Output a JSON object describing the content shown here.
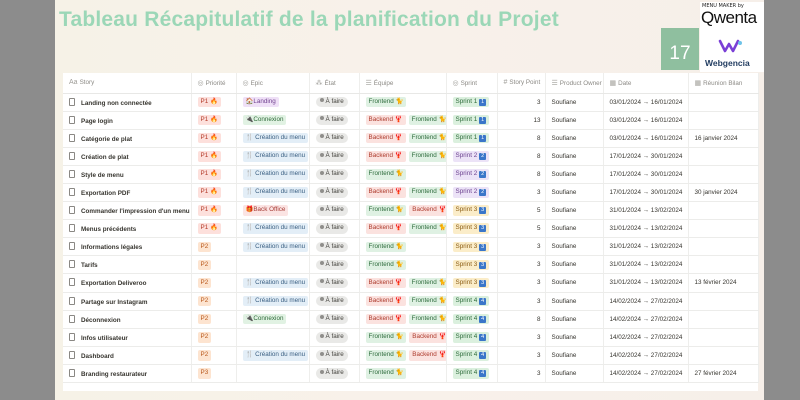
{
  "title": "Tableau Récapitulatif de la planification du Projet",
  "page_number": "17",
  "logo": {
    "maker": "MENU MAKER by",
    "brand": "Qwenta",
    "partner": "Webgencia"
  },
  "colors": {
    "title": "#9bd7b7",
    "page_badge": "#8fbf9f",
    "sprint_badge": "#3a76c9"
  },
  "columns": [
    {
      "label": "Story",
      "icon": "Aa"
    },
    {
      "label": "Priorité",
      "icon": "status-icon"
    },
    {
      "label": "Epic",
      "icon": "status-icon"
    },
    {
      "label": "État",
      "icon": "loader-icon"
    },
    {
      "label": "Équipe",
      "icon": "list-icon"
    },
    {
      "label": "Sprint",
      "icon": "status-icon"
    },
    {
      "label": "Story Point",
      "icon": "hash-icon"
    },
    {
      "label": "Product Owner",
      "icon": "list-icon"
    },
    {
      "label": "Date",
      "icon": "calendar-icon"
    },
    {
      "label": "Réunion Bilan",
      "icon": "calendar-icon"
    }
  ],
  "rows": [
    {
      "story": "Landing non connectée",
      "priority": "P1 🔥",
      "epic": "🏠Landing",
      "state": "À faire",
      "teams": [
        "Frontend 🐈"
      ],
      "sprint": "Sprint 1",
      "sprint_num": "1",
      "points": "3",
      "po": "Soufiane",
      "date": "03/01/2024 → 16/01/2024",
      "review": ""
    },
    {
      "story": "Page login",
      "priority": "P1 🔥",
      "epic": "🔌Connexion",
      "state": "À faire",
      "teams": [
        "Backend 🦞",
        "Frontend 🐈"
      ],
      "sprint": "Sprint 1",
      "sprint_num": "1",
      "points": "13",
      "po": "Soufiane",
      "date": "03/01/2024 → 16/01/2024",
      "review": ""
    },
    {
      "story": "Catégorie de plat",
      "priority": "P1 🔥",
      "epic": "🍴 Création du menu",
      "state": "À faire",
      "teams": [
        "Backend 🦞",
        "Frontend 🐈"
      ],
      "sprint": "Sprint 1",
      "sprint_num": "1",
      "points": "8",
      "po": "Soufiane",
      "date": "03/01/2024 → 16/01/2024",
      "review": "16 janvier 2024"
    },
    {
      "story": "Création de plat",
      "priority": "P1 🔥",
      "epic": "🍴 Création du menu",
      "state": "À faire",
      "teams": [
        "Backend 🦞",
        "Frontend 🐈"
      ],
      "sprint": "Sprint 2",
      "sprint_num": "2",
      "points": "8",
      "po": "Soufiane",
      "date": "17/01/2024 → 30/01/2024",
      "review": ""
    },
    {
      "story": "Style de menu",
      "priority": "P1 🔥",
      "epic": "🍴 Création du menu",
      "state": "À faire",
      "teams": [
        "Frontend 🐈"
      ],
      "sprint": "Sprint 2",
      "sprint_num": "2",
      "points": "8",
      "po": "Soufiane",
      "date": "17/01/2024 → 30/01/2024",
      "review": ""
    },
    {
      "story": "Exportation PDF",
      "priority": "P1 🔥",
      "epic": "🍴 Création du menu",
      "state": "À faire",
      "teams": [
        "Backend 🦞",
        "Frontend 🐈"
      ],
      "sprint": "Sprint 2",
      "sprint_num": "2",
      "points": "3",
      "po": "Soufiane",
      "date": "17/01/2024 → 30/01/2024",
      "review": "30 janvier 2024"
    },
    {
      "story": "Commander l'impression d'un menu",
      "priority": "P1 🔥",
      "epic": "🎁Back Office",
      "state": "À faire",
      "teams": [
        "Frontend 🐈",
        "Backend 🦞"
      ],
      "sprint": "Sprint 3",
      "sprint_num": "3",
      "points": "5",
      "po": "Soufiane",
      "date": "31/01/2024 → 13/02/2024",
      "review": ""
    },
    {
      "story": "Menus précédents",
      "priority": "P1 🔥",
      "epic": "🍴 Création du menu",
      "state": "À faire",
      "teams": [
        "Backend 🦞",
        "Frontend 🐈"
      ],
      "sprint": "Sprint 3",
      "sprint_num": "3",
      "points": "5",
      "po": "Soufiane",
      "date": "31/01/2024 → 13/02/2024",
      "review": ""
    },
    {
      "story": "Informations légales",
      "priority": "P2",
      "epic": "🍴 Création du menu",
      "state": "À faire",
      "teams": [
        "Frontend 🐈"
      ],
      "sprint": "Sprint 3",
      "sprint_num": "3",
      "points": "3",
      "po": "Soufiane",
      "date": "31/01/2024 → 13/02/2024",
      "review": ""
    },
    {
      "story": "Tarifs",
      "priority": "P2",
      "epic": "",
      "state": "À faire",
      "teams": [
        "Frontend 🐈"
      ],
      "sprint": "Sprint 3",
      "sprint_num": "3",
      "points": "3",
      "po": "Soufiane",
      "date": "31/01/2024 → 13/02/2024",
      "review": ""
    },
    {
      "story": "Exportation Deliveroo",
      "priority": "P2",
      "epic": "🍴 Création du menu",
      "state": "À faire",
      "teams": [
        "Backend 🦞",
        "Frontend 🐈"
      ],
      "sprint": "Sprint 3",
      "sprint_num": "3",
      "points": "3",
      "po": "Soufiane",
      "date": "31/01/2024 → 13/02/2024",
      "review": "13 février 2024"
    },
    {
      "story": "Partage sur Instagram",
      "priority": "P2",
      "epic": "🍴 Création du menu",
      "state": "À faire",
      "teams": [
        "Backend 🦞",
        "Frontend 🐈"
      ],
      "sprint": "Sprint 4",
      "sprint_num": "4",
      "points": "3",
      "po": "Soufiane",
      "date": "14/02/2024 → 27/02/2024",
      "review": ""
    },
    {
      "story": "Déconnexion",
      "priority": "P2",
      "epic": "🔌Connexion",
      "state": "À faire",
      "teams": [
        "Backend 🦞",
        "Frontend 🐈"
      ],
      "sprint": "Sprint 4",
      "sprint_num": "4",
      "points": "8",
      "po": "Soufiane",
      "date": "14/02/2024 → 27/02/2024",
      "review": ""
    },
    {
      "story": "Infos utilisateur",
      "priority": "P2",
      "epic": "",
      "state": "À faire",
      "teams": [
        "Frontend 🐈",
        "Backend 🦞"
      ],
      "sprint": "Sprint 4",
      "sprint_num": "4",
      "points": "3",
      "po": "Soufiane",
      "date": "14/02/2024 → 27/02/2024",
      "review": ""
    },
    {
      "story": "Dashboard",
      "priority": "P2",
      "epic": "🍴 Création du menu",
      "state": "À faire",
      "teams": [
        "Frontend 🐈",
        "Backend 🦞"
      ],
      "sprint": "Sprint 4",
      "sprint_num": "4",
      "points": "3",
      "po": "Soufiane",
      "date": "14/02/2024 → 27/02/2024",
      "review": ""
    },
    {
      "story": "Branding restaurateur",
      "priority": "P3",
      "epic": "",
      "state": "À faire",
      "teams": [
        "Frontend 🐈"
      ],
      "sprint": "Sprint 4",
      "sprint_num": "4",
      "points": "3",
      "po": "Soufiane",
      "date": "14/02/2024 → 27/02/2024",
      "review": "27 février 2024"
    }
  ]
}
